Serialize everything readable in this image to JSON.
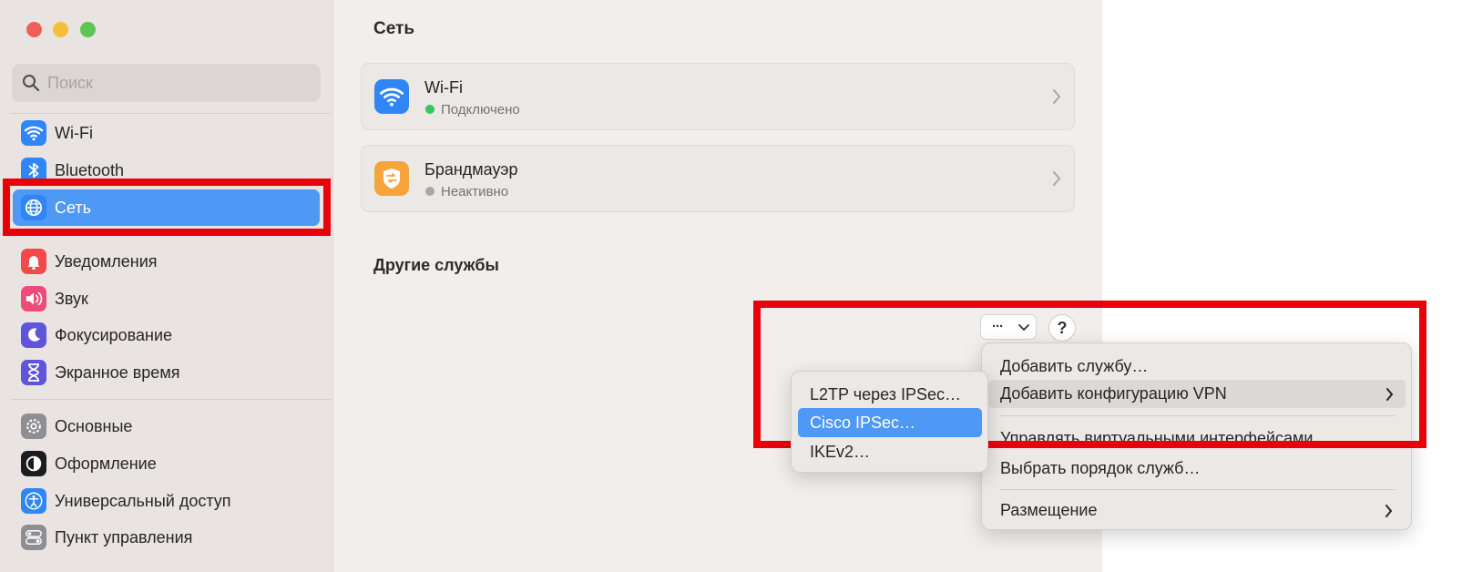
{
  "window": {
    "title": "Сеть"
  },
  "sidebar": {
    "search_placeholder": "Поиск",
    "items": [
      {
        "label": "Wi-Fi",
        "icon": "wifi-icon",
        "active": false
      },
      {
        "label": "Bluetooth",
        "icon": "bluetooth-icon",
        "active": false
      },
      {
        "label": "Сеть",
        "icon": "globe-icon",
        "active": true
      },
      {
        "label": "Уведомления",
        "icon": "bell-icon",
        "active": false
      },
      {
        "label": "Звук",
        "icon": "speaker-icon",
        "active": false
      },
      {
        "label": "Фокусирование",
        "icon": "moon-icon",
        "active": false
      },
      {
        "label": "Экранное время",
        "icon": "hourglass-icon",
        "active": false
      },
      {
        "label": "Основные",
        "icon": "gear-icon",
        "active": false
      },
      {
        "label": "Оформление",
        "icon": "appearance-icon",
        "active": false
      },
      {
        "label": "Универсальный доступ",
        "icon": "accessibility-icon",
        "active": false
      },
      {
        "label": "Пункт управления",
        "icon": "toggles-icon",
        "active": false
      }
    ]
  },
  "main": {
    "cards": [
      {
        "title": "Wi-Fi",
        "status": "Подключено",
        "status_color": "#34c759",
        "icon": "wifi-icon"
      },
      {
        "title": "Брандмауэр",
        "status": "Неактивно",
        "status_color": "#a9a6a4",
        "icon": "firewall-icon"
      }
    ],
    "section_title": "Другие службы",
    "more_label": "···",
    "help_label": "?"
  },
  "action_menu": {
    "items": [
      {
        "label": "Добавить службу…"
      },
      {
        "label": "Добавить конфигурацию VPN",
        "submenu": true
      },
      {
        "label": "Управлять виртуальными интерфейсами…"
      },
      {
        "label": "Выбрать порядок служб…"
      },
      {
        "label": "Размещение",
        "submenu": true
      }
    ]
  },
  "vpn_submenu": {
    "items": [
      {
        "label": "L2TP через IPSec…"
      },
      {
        "label": "Cisco IPSec…",
        "selected": true
      },
      {
        "label": "IKEv2…"
      }
    ]
  },
  "colors": {
    "accent": "#4e98f6",
    "highlight_box": "#e8000b"
  }
}
